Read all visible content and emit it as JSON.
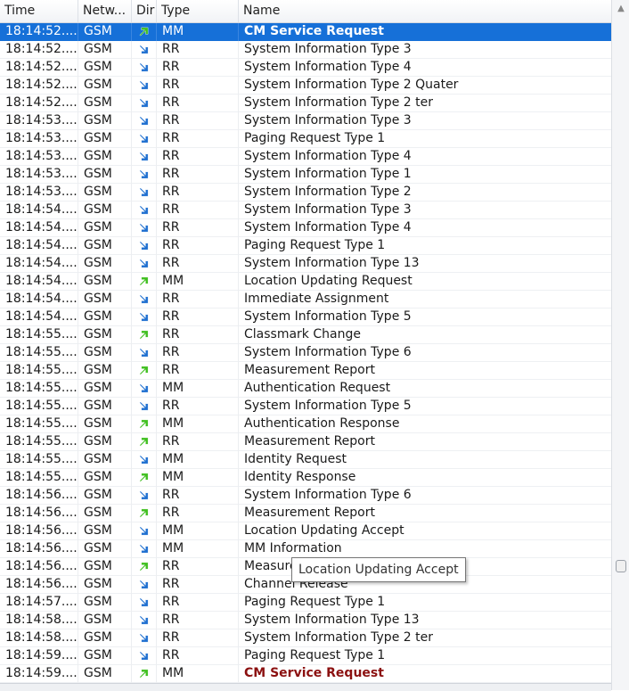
{
  "columns": {
    "time": "Time",
    "network": "Netw...",
    "dir": "Dir",
    "type": "Type",
    "name": "Name"
  },
  "colors": {
    "selection": "#1670d8",
    "downlink_arrow": "#1e6fd0",
    "uplink_arrow": "#3fbf1f",
    "highlight_text": "#8b1010"
  },
  "rows": [
    {
      "time": "18:14:52....",
      "network": "GSM",
      "dir": "up",
      "type": "MM",
      "name": "CM Service Request",
      "selected": true
    },
    {
      "time": "18:14:52....",
      "network": "GSM",
      "dir": "down",
      "type": "RR",
      "name": "System Information Type 3"
    },
    {
      "time": "18:14:52....",
      "network": "GSM",
      "dir": "down",
      "type": "RR",
      "name": "System Information Type 4"
    },
    {
      "time": "18:14:52....",
      "network": "GSM",
      "dir": "down",
      "type": "RR",
      "name": "System Information Type 2 Quater"
    },
    {
      "time": "18:14:52....",
      "network": "GSM",
      "dir": "down",
      "type": "RR",
      "name": "System Information Type 2 ter"
    },
    {
      "time": "18:14:53....",
      "network": "GSM",
      "dir": "down",
      "type": "RR",
      "name": "System Information Type 3"
    },
    {
      "time": "18:14:53....",
      "network": "GSM",
      "dir": "down",
      "type": "RR",
      "name": "Paging Request Type 1"
    },
    {
      "time": "18:14:53....",
      "network": "GSM",
      "dir": "down",
      "type": "RR",
      "name": "System Information Type 4"
    },
    {
      "time": "18:14:53....",
      "network": "GSM",
      "dir": "down",
      "type": "RR",
      "name": "System Information Type 1"
    },
    {
      "time": "18:14:53....",
      "network": "GSM",
      "dir": "down",
      "type": "RR",
      "name": "System Information Type 2"
    },
    {
      "time": "18:14:54....",
      "network": "GSM",
      "dir": "down",
      "type": "RR",
      "name": "System Information Type 3"
    },
    {
      "time": "18:14:54....",
      "network": "GSM",
      "dir": "down",
      "type": "RR",
      "name": "System Information Type 4"
    },
    {
      "time": "18:14:54....",
      "network": "GSM",
      "dir": "down",
      "type": "RR",
      "name": "Paging Request Type 1"
    },
    {
      "time": "18:14:54....",
      "network": "GSM",
      "dir": "down",
      "type": "RR",
      "name": "System Information Type 13"
    },
    {
      "time": "18:14:54....",
      "network": "GSM",
      "dir": "up",
      "type": "MM",
      "name": "Location Updating Request"
    },
    {
      "time": "18:14:54....",
      "network": "GSM",
      "dir": "down",
      "type": "RR",
      "name": "Immediate Assignment"
    },
    {
      "time": "18:14:54....",
      "network": "GSM",
      "dir": "down",
      "type": "RR",
      "name": "System Information Type 5"
    },
    {
      "time": "18:14:55....",
      "network": "GSM",
      "dir": "up",
      "type": "RR",
      "name": "Classmark Change"
    },
    {
      "time": "18:14:55....",
      "network": "GSM",
      "dir": "down",
      "type": "RR",
      "name": "System Information Type 6"
    },
    {
      "time": "18:14:55....",
      "network": "GSM",
      "dir": "up",
      "type": "RR",
      "name": "Measurement Report"
    },
    {
      "time": "18:14:55....",
      "network": "GSM",
      "dir": "down",
      "type": "MM",
      "name": "Authentication Request"
    },
    {
      "time": "18:14:55....",
      "network": "GSM",
      "dir": "down",
      "type": "RR",
      "name": "System Information Type 5"
    },
    {
      "time": "18:14:55....",
      "network": "GSM",
      "dir": "up",
      "type": "MM",
      "name": "Authentication Response"
    },
    {
      "time": "18:14:55....",
      "network": "GSM",
      "dir": "up",
      "type": "RR",
      "name": "Measurement Report"
    },
    {
      "time": "18:14:55....",
      "network": "GSM",
      "dir": "down",
      "type": "MM",
      "name": "Identity Request"
    },
    {
      "time": "18:14:55....",
      "network": "GSM",
      "dir": "up",
      "type": "MM",
      "name": "Identity Response"
    },
    {
      "time": "18:14:56....",
      "network": "GSM",
      "dir": "down",
      "type": "RR",
      "name": "System Information Type 6"
    },
    {
      "time": "18:14:56....",
      "network": "GSM",
      "dir": "up",
      "type": "RR",
      "name": "Measurement Report"
    },
    {
      "time": "18:14:56....",
      "network": "GSM",
      "dir": "down",
      "type": "MM",
      "name": "Location Updating Accept"
    },
    {
      "time": "18:14:56....",
      "network": "GSM",
      "dir": "down",
      "type": "MM",
      "name": "MM Information"
    },
    {
      "time": "18:14:56....",
      "network": "GSM",
      "dir": "up",
      "type": "RR",
      "name": "Measure"
    },
    {
      "time": "18:14:56....",
      "network": "GSM",
      "dir": "down",
      "type": "RR",
      "name": "Channel Release"
    },
    {
      "time": "18:14:57....",
      "network": "GSM",
      "dir": "down",
      "type": "RR",
      "name": "Paging Request Type 1"
    },
    {
      "time": "18:14:58....",
      "network": "GSM",
      "dir": "down",
      "type": "RR",
      "name": "System Information Type 13"
    },
    {
      "time": "18:14:58....",
      "network": "GSM",
      "dir": "down",
      "type": "RR",
      "name": "System Information Type 2 ter"
    },
    {
      "time": "18:14:59....",
      "network": "GSM",
      "dir": "down",
      "type": "RR",
      "name": "Paging Request Type 1"
    },
    {
      "time": "18:14:59....",
      "network": "GSM",
      "dir": "up",
      "type": "MM",
      "name": "CM Service Request",
      "highlight": true
    }
  ],
  "tooltip": {
    "text": "Location Updating Accept"
  }
}
